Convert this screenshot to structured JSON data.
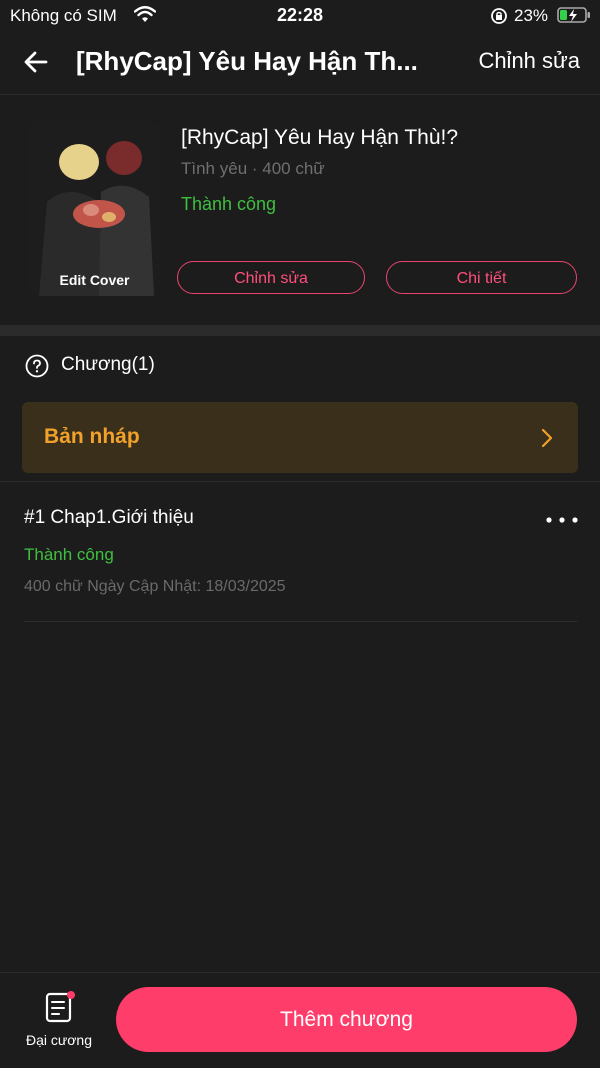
{
  "status_bar": {
    "carrier": "Không có SIM",
    "time": "22:28",
    "battery": "23%"
  },
  "header": {
    "title": "[RhyCap] Yêu Hay Hận Th...",
    "edit_label": "Chỉnh sửa",
    "back_icon": "back-arrow-icon"
  },
  "book": {
    "cover_label": "Edit Cover",
    "title": "[RhyCap] Yêu Hay Hận Thù!?",
    "meta": "Tình yêu · 400 chữ",
    "status": "Thành công",
    "edit_button": "Chỉnh sửa",
    "detail_button": "Chi tiết"
  },
  "chapters": {
    "title": "Chương(1)",
    "draft_label": "Bản nháp",
    "items": [
      {
        "title": "#1 Chap1.Giới thiệu",
        "status": "Thành công",
        "meta": "400 chữ Ngày Cập Nhật: 18/03/2025"
      }
    ]
  },
  "bottom": {
    "outline_label": "Đại cương",
    "add_button": "Thêm chương"
  },
  "colors": {
    "background": "#1c1c1c",
    "accent": "#ff3d6b",
    "success": "#3fbf3f",
    "draft": "#f2a12a"
  }
}
